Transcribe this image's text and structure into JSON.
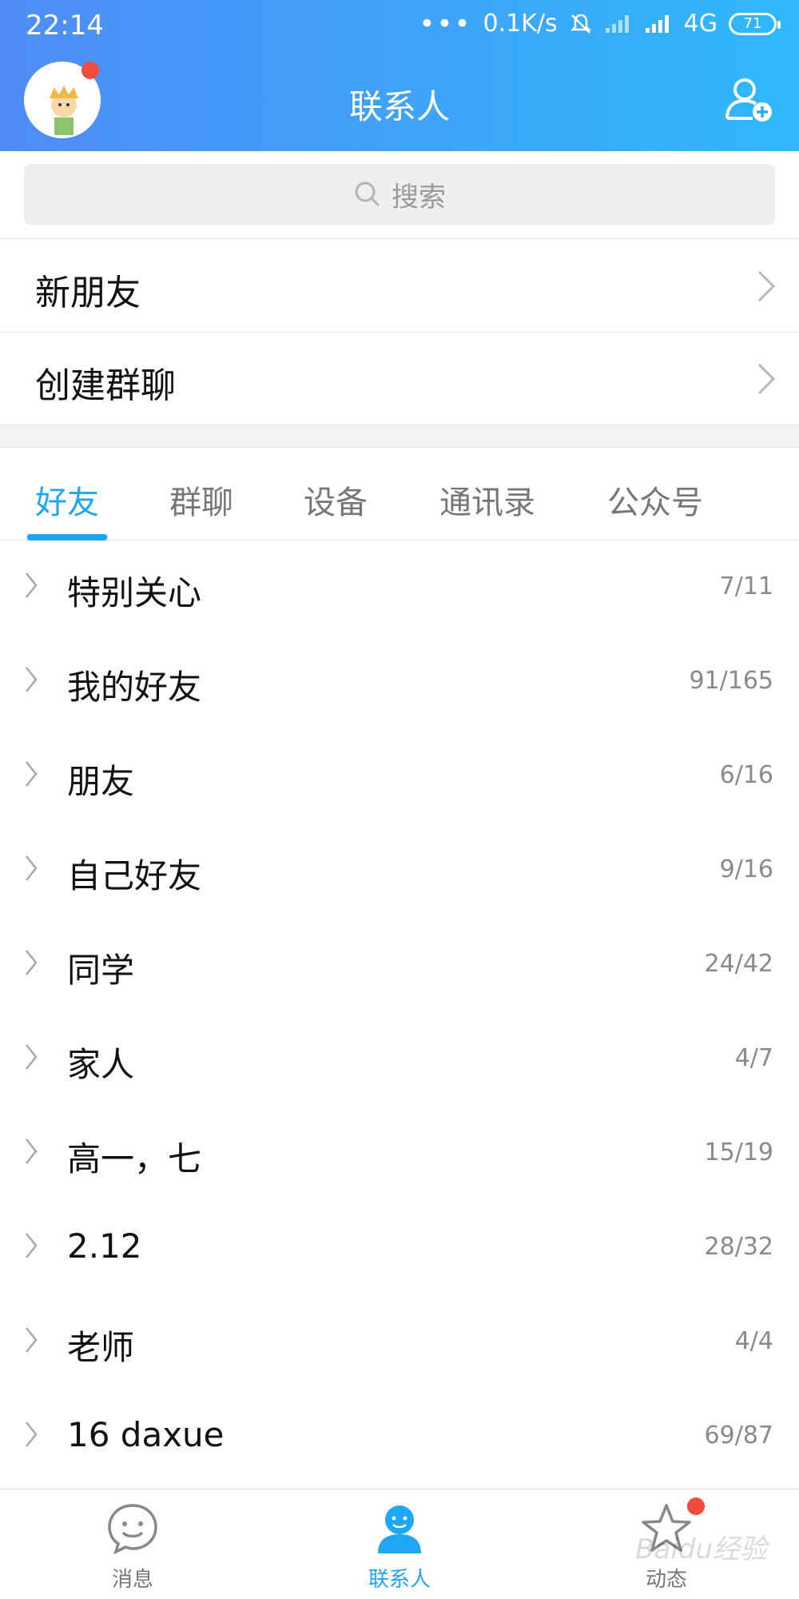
{
  "status_bar": {
    "time": "22:14",
    "net_speed": "0.1K/s",
    "network_type": "4G",
    "battery": "71"
  },
  "header": {
    "title": "联系人",
    "avatar_icon": "avatar",
    "add_icon": "add-friend-icon"
  },
  "search": {
    "placeholder": "搜索"
  },
  "menu": [
    {
      "label": "新朋友"
    },
    {
      "label": "创建群聊"
    }
  ],
  "tabs": [
    {
      "label": "好友",
      "active": true
    },
    {
      "label": "群聊",
      "active": false
    },
    {
      "label": "设备",
      "active": false
    },
    {
      "label": "通讯录",
      "active": false
    },
    {
      "label": "公众号",
      "active": false
    }
  ],
  "groups": [
    {
      "name": "特别关心",
      "count": "7/11"
    },
    {
      "name": "我的好友",
      "count": "91/165"
    },
    {
      "name": "朋友",
      "count": "6/16"
    },
    {
      "name": "自己好友",
      "count": "9/16"
    },
    {
      "name": "同学",
      "count": "24/42"
    },
    {
      "name": "家人",
      "count": "4/7"
    },
    {
      "name": "高一，七",
      "count": "15/19"
    },
    {
      "name": "2.12",
      "count": "28/32"
    },
    {
      "name": "老师",
      "count": "4/4"
    },
    {
      "name": "16  daxue",
      "count": "69/87"
    }
  ],
  "bottom_nav": [
    {
      "label": "消息",
      "active": false
    },
    {
      "label": "联系人",
      "active": true
    },
    {
      "label": "动态",
      "active": false
    }
  ],
  "colors": {
    "accent": "#1fa6f5",
    "header_start": "#4f8cf7",
    "header_end": "#2fb8fb",
    "badge": "#f24b3f"
  },
  "watermark": "Baidu经验"
}
